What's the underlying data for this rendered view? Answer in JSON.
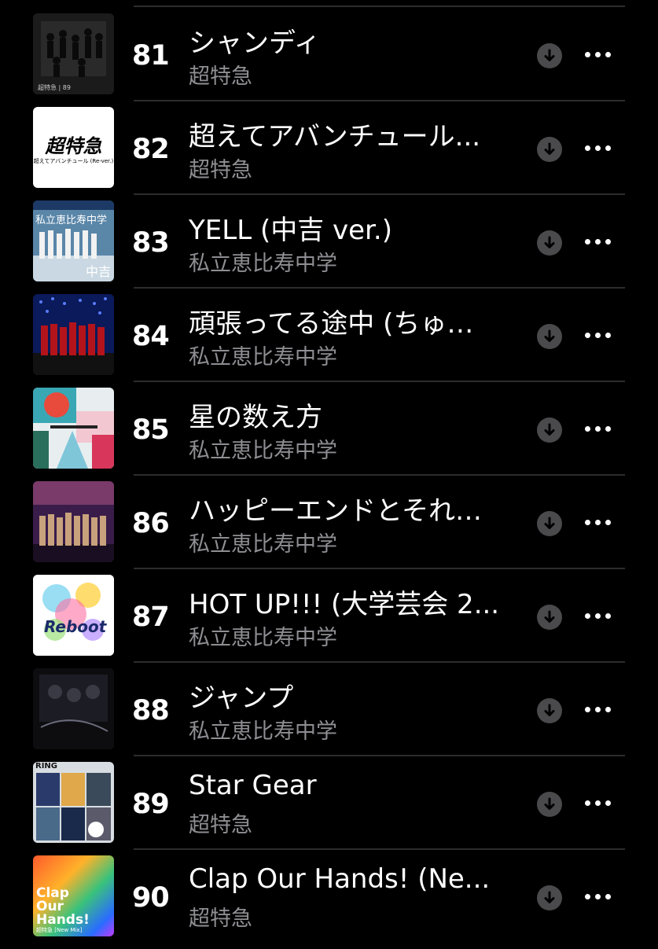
{
  "chart": {
    "rows": [
      {
        "rank": "81",
        "title": "シャンディ",
        "artist": "超特急",
        "art": "photo-group-dark",
        "art_text": "超特急 | 89"
      },
      {
        "rank": "82",
        "title": "超えてアバンチュール...",
        "artist": "超特急",
        "art": "logo-white",
        "art_text": "超特急",
        "art_sub": "超えてアバンチュール (Re-ver.)"
      },
      {
        "rank": "83",
        "title": "YELL (中吉 ver.)",
        "artist": "私立恵比寿中学",
        "art": "photo-blue",
        "art_text": "私立恵比寿中学",
        "art_sub": "中吉"
      },
      {
        "rank": "84",
        "title": "頑張ってる途中 (ちゅ…",
        "artist": "私立恵比寿中学",
        "art": "photo-stage",
        "art_text": ""
      },
      {
        "rank": "85",
        "title": "星の数え方",
        "artist": "私立恵比寿中学",
        "art": "illustration",
        "art_text": ""
      },
      {
        "rank": "86",
        "title": "ハッピーエンドとそれ…",
        "artist": "私立恵比寿中学",
        "art": "photo-purple",
        "art_text": ""
      },
      {
        "rank": "87",
        "title": "HOT UP!!! (大学芸会 2...",
        "artist": "私立恵比寿中学",
        "art": "colorful-logo",
        "art_text": "Reboot"
      },
      {
        "rank": "88",
        "title": "ジャンプ",
        "artist": "私立恵比寿中学",
        "art": "photo-dark",
        "art_text": ""
      },
      {
        "rank": "89",
        "title": "Star Gear",
        "artist": "超特急",
        "art": "photo-grid",
        "art_text": "RING"
      },
      {
        "rank": "90",
        "title": "Clap Our Hands! (Ne...",
        "artist": "超特急",
        "art": "gradient",
        "art_text": "Clap Our Hands!",
        "art_sub": "超特急 [New Mix]"
      }
    ],
    "download_icon": "arrow-down-circle-icon",
    "more_icon": "ellipsis-icon"
  }
}
